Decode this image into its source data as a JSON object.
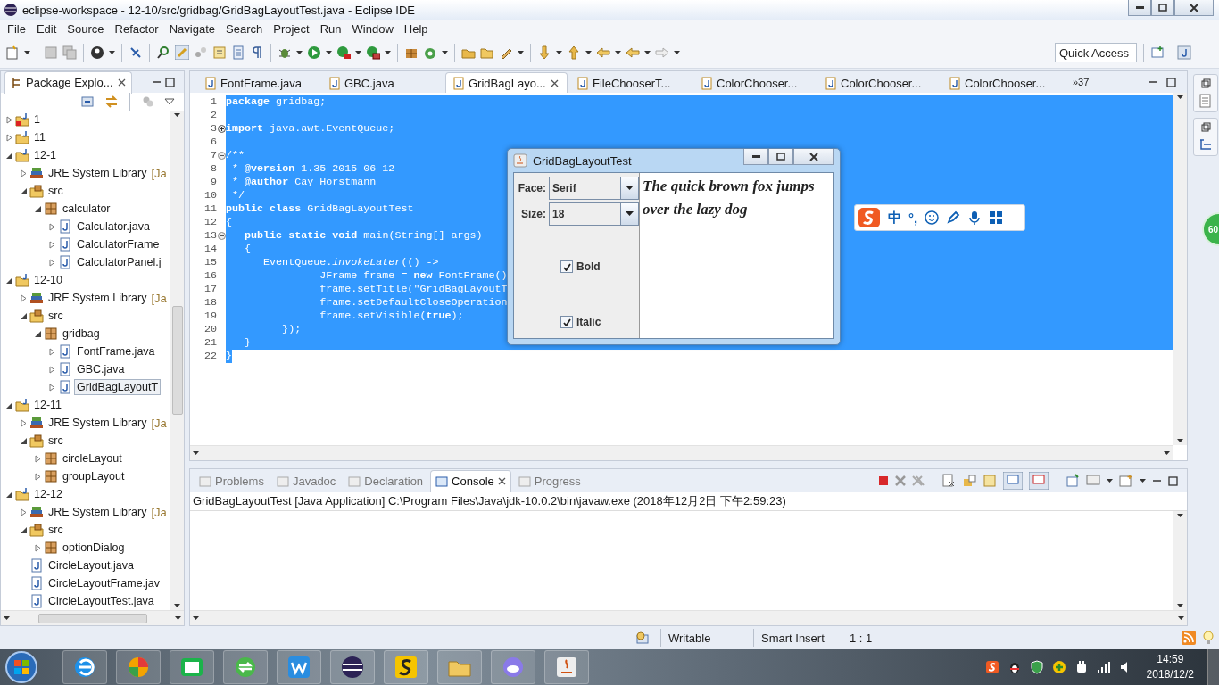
{
  "window": {
    "title": "eclipse-workspace - 12-10/src/gridbag/GridBagLayoutTest.java - Eclipse IDE"
  },
  "menu": [
    "File",
    "Edit",
    "Source",
    "Refactor",
    "Navigate",
    "Search",
    "Project",
    "Run",
    "Window",
    "Help"
  ],
  "quick_access": {
    "placeholder": "Quick Access"
  },
  "package_explorer": {
    "title": "Package Explo...",
    "tree": [
      {
        "label": "1",
        "kind": "project",
        "error": true,
        "expanded": false
      },
      {
        "label": "11",
        "kind": "project",
        "error": false,
        "expanded": false
      },
      {
        "label": "12-1",
        "kind": "project",
        "error": false,
        "expanded": true,
        "children": [
          {
            "label": "JRE System Library",
            "decoration": "[Ja",
            "kind": "library",
            "expanded": false
          },
          {
            "label": "src",
            "kind": "src",
            "expanded": true,
            "children": [
              {
                "label": "calculator",
                "kind": "package",
                "expanded": true,
                "children": [
                  {
                    "label": "Calculator.java",
                    "kind": "java",
                    "expanded": false
                  },
                  {
                    "label": "CalculatorFrame",
                    "kind": "java",
                    "expanded": false
                  },
                  {
                    "label": "CalculatorPanel.j",
                    "kind": "java",
                    "expanded": false
                  }
                ]
              }
            ]
          }
        ]
      },
      {
        "label": "12-10",
        "kind": "project",
        "error": false,
        "expanded": true,
        "children": [
          {
            "label": "JRE System Library",
            "decoration": "[Ja",
            "kind": "library",
            "expanded": false
          },
          {
            "label": "src",
            "kind": "src",
            "expanded": true,
            "children": [
              {
                "label": "gridbag",
                "kind": "package",
                "expanded": true,
                "children": [
                  {
                    "label": "FontFrame.java",
                    "kind": "java",
                    "expanded": false,
                    "selected": false
                  },
                  {
                    "label": "GBC.java",
                    "kind": "java",
                    "expanded": false,
                    "selected": false
                  },
                  {
                    "label": "GridBagLayoutT",
                    "kind": "java",
                    "expanded": false,
                    "selected": true
                  }
                ]
              }
            ]
          }
        ]
      },
      {
        "label": "12-11",
        "kind": "project",
        "error": false,
        "expanded": true,
        "children": [
          {
            "label": "JRE System Library",
            "decoration": "[Ja",
            "kind": "library",
            "expanded": false
          },
          {
            "label": "src",
            "kind": "src",
            "expanded": true,
            "children": [
              {
                "label": "circleLayout",
                "kind": "package",
                "expanded": false
              },
              {
                "label": "groupLayout",
                "kind": "package",
                "expanded": false
              }
            ]
          }
        ]
      },
      {
        "label": "12-12",
        "kind": "project",
        "error": false,
        "expanded": true,
        "children": [
          {
            "label": "JRE System Library",
            "decoration": "[Ja",
            "kind": "library",
            "expanded": false
          },
          {
            "label": "src",
            "kind": "src",
            "expanded": true,
            "children": [
              {
                "label": "optionDialog",
                "kind": "package",
                "expanded": false
              }
            ]
          },
          {
            "label": "CircleLayout.java",
            "kind": "java"
          },
          {
            "label": "CircleLayoutFrame.jav",
            "kind": "java"
          },
          {
            "label": "CircleLayoutTest.java",
            "kind": "java"
          }
        ]
      }
    ]
  },
  "editor_tabs": [
    {
      "label": "FontFrame.java",
      "selected": false
    },
    {
      "label": "GBC.java",
      "selected": false
    },
    {
      "label": "GridBagLayo...",
      "selected": true
    },
    {
      "label": "FileChooserT...",
      "selected": false
    },
    {
      "label": "ColorChooser...",
      "selected": false
    },
    {
      "label": "ColorChooser...",
      "selected": false
    },
    {
      "label": "ColorChooser...",
      "selected": false
    }
  ],
  "more_tabs": "»37",
  "code": [
    {
      "num": "1",
      "text": "**package** gridbag;",
      "selected": true,
      "full_width": true
    },
    {
      "num": "2",
      "selected": true,
      "full_width": true
    },
    {
      "num": "3",
      "text": "**import** java.awt.EventQueue;",
      "folded": true,
      "selected": true,
      "full_width": true
    },
    {
      "num": "6",
      "selected": true,
      "full_width": true
    },
    {
      "num": "7",
      "text": "/**",
      "folded": false,
      "selected": true,
      "full_width": true
    },
    {
      "num": "8",
      "text": " * **@version** 1.35 2015-06-12",
      "selected": true,
      "full_width": true
    },
    {
      "num": "9",
      "text": " * **@author** Cay Horstmann",
      "selected": true,
      "full_width": true
    },
    {
      "num": "10",
      "text": " */",
      "selected": true,
      "full_width": true
    },
    {
      "num": "11",
      "text": "**public** **class** GridBagLayoutTest",
      "selected": true,
      "full_width": true
    },
    {
      "num": "12",
      "text": "{",
      "selected": true,
      "full_width": true
    },
    {
      "num": "13",
      "text": "   **public** **static** **void** main(String[] args)",
      "folded": false,
      "selected": true,
      "full_width": true
    },
    {
      "num": "14",
      "text": "   {",
      "selected": true,
      "full_width": true
    },
    {
      "num": "15",
      "text": "      EventQueue.*invokeLater*(() ->",
      "selected": true,
      "full_width": true
    },
    {
      "num": "16",
      "text": "               JFrame frame = **new** FontFrame()",
      "selected": true,
      "full_width": true
    },
    {
      "num": "17",
      "text": "               frame.setTitle(\"GridBagLayoutT",
      "selected": true,
      "full_width": true
    },
    {
      "num": "18",
      "text": "               frame.setDefaultCloseOperation",
      "selected": true,
      "full_width": true
    },
    {
      "num": "19",
      "text": "               frame.setVisible(**true**);",
      "selected": true,
      "full_width": true
    },
    {
      "num": "20",
      "text": "         });",
      "selected": true,
      "full_width": true
    },
    {
      "num": "21",
      "text": "   }",
      "selected": true,
      "full_width": true
    },
    {
      "num": "22",
      "text": "}",
      "selected": true,
      "full_width": false
    }
  ],
  "dialog": {
    "title": "GridBagLayoutTest",
    "face_label": "Face:",
    "face": "Serif",
    "size_label": "Size:",
    "size": "18",
    "checkboxes": [
      {
        "label": "Bold",
        "checked": true
      },
      {
        "label": "Italic",
        "checked": true
      }
    ],
    "sample": "The quick brown fox jumps over the lazy dog"
  },
  "ime_bar": {
    "mode": "中",
    "punctuation": "°,"
  },
  "side_badge": "60",
  "bottom_tabs": [
    {
      "label": "Problems",
      "selected": false
    },
    {
      "label": "Javadoc",
      "selected": false
    },
    {
      "label": "Declaration",
      "selected": false
    },
    {
      "label": "Console",
      "selected": true
    },
    {
      "label": "Progress",
      "selected": false
    }
  ],
  "console_header": "GridBagLayoutTest [Java Application] C:\\Program Files\\Java\\jdk-10.0.2\\bin\\javaw.exe (2018年12月2日 下午2:59:23)",
  "status_bar": [
    "Writable",
    "Smart Insert",
    "1 : 1"
  ],
  "taskbar": {
    "time": "14:59",
    "date": "2018/12/2"
  }
}
